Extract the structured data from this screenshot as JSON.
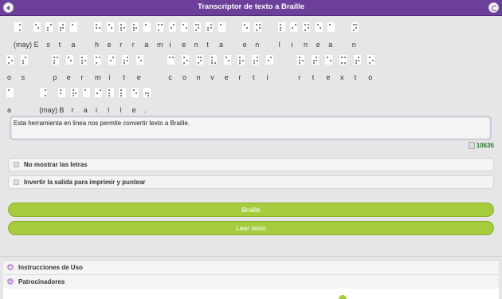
{
  "header": {
    "title": "Transcriptor de texto a Braille",
    "back_icon": "back-arrow-icon",
    "refresh_icon": "refresh-icon",
    "accent": "#6b3f9a"
  },
  "braille": {
    "line1_labels": [
      "(may)",
      "E",
      "s",
      "t",
      "a",
      "h",
      "e",
      "r",
      "r",
      "a",
      "m",
      "i",
      "e",
      "n",
      "t",
      "a",
      "e",
      "n",
      "l",
      "i",
      "n",
      "e",
      "a",
      "n"
    ],
    "line2_labels": [
      "o",
      "s",
      "p",
      "e",
      "r",
      "m",
      "i",
      "t",
      "e",
      "c",
      "o",
      "n",
      "v",
      "e",
      "r",
      "t",
      "i",
      "r",
      "t",
      "e",
      "x",
      "t",
      "o"
    ],
    "line3_labels": [
      "a",
      "(may)",
      "B",
      "r",
      "a",
      "i",
      "l",
      "l",
      "e",
      "."
    ]
  },
  "input": {
    "value": "Esta herramienta en linea nos permite convertir texto a Braille."
  },
  "counter": {
    "value": "10636"
  },
  "options": [
    {
      "label": "No mostrar las letras"
    },
    {
      "label": "Invertir la salida para imprimir y puntear"
    }
  ],
  "buttons": {
    "braille": "Braille",
    "leer": "Leer texto",
    "color": "#a6cc3e"
  },
  "accordion": [
    {
      "label": "Instrucciones de Uso",
      "icon": "plus-circle-icon"
    },
    {
      "label": "Patrocinadores",
      "icon": "minus-circle-icon"
    }
  ]
}
